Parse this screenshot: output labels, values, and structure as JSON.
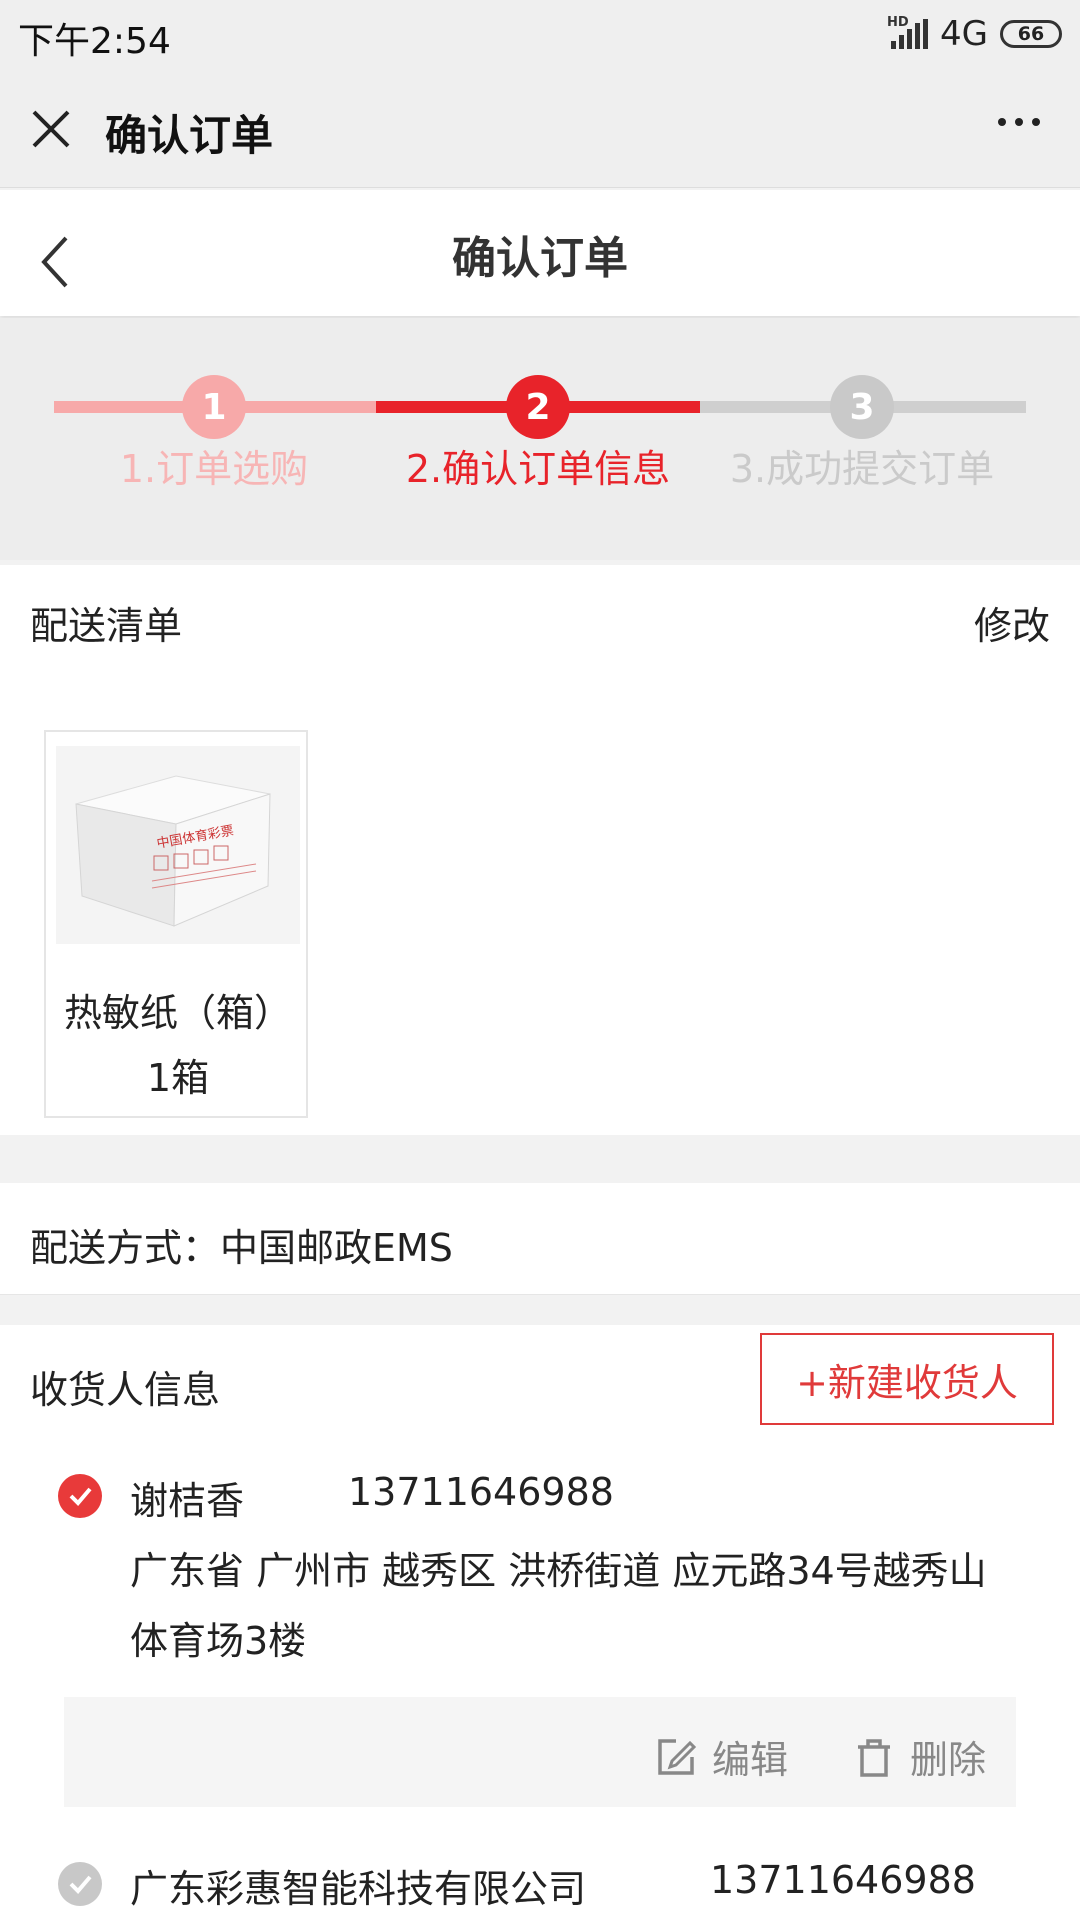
{
  "status_bar": {
    "time": "下午2:54",
    "network": "4G",
    "battery": "66"
  },
  "webview": {
    "title": "确认订单"
  },
  "header": {
    "title": "确认订单"
  },
  "steps": [
    {
      "number": "1",
      "label": "1.订单选购",
      "state": "done"
    },
    {
      "number": "2",
      "label": "2.确认订单信息",
      "state": "active"
    },
    {
      "number": "3",
      "label": "3.成功提交订单",
      "state": "pending"
    }
  ],
  "delivery_list": {
    "title": "配送清单",
    "edit_label": "修改",
    "items": [
      {
        "name": "热敏纸（箱）",
        "quantity": "1箱",
        "box_text": "中国体育彩票"
      }
    ]
  },
  "delivery_method": {
    "text": "配送方式：中国邮政EMS"
  },
  "receiver": {
    "title": "收货人信息",
    "add_label": "+新建收货人",
    "entries": [
      {
        "name": "谢桔香",
        "phone": "13711646988",
        "address_line1": "广东省 广州市 越秀区 洪桥街道 应元路34号越秀山",
        "address_line2": "体育场3楼",
        "selected": true
      },
      {
        "name": "广东彩惠智能科技有限公司",
        "phone": "13711646988",
        "selected": false
      }
    ],
    "edit_label": "编辑",
    "delete_label": "删除"
  },
  "colors": {
    "accent": "#e83a3a",
    "done": "#f7a9a9",
    "pending": "#c9c9c9"
  }
}
